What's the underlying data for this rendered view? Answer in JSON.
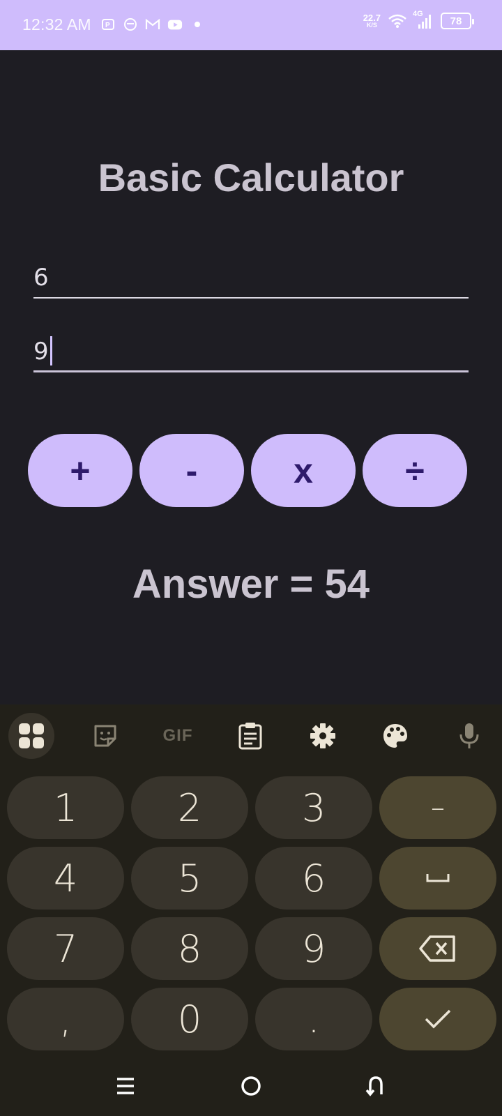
{
  "status_bar": {
    "time": "12:32 AM",
    "net_speed_value": "22.7",
    "net_speed_unit": "K/S",
    "network_label": "4G",
    "battery": "78"
  },
  "app": {
    "title": "Basic Calculator",
    "first_input_value": "6",
    "second_input_value": "9",
    "operators": {
      "add": "+",
      "subtract": "-",
      "multiply": "x",
      "divide": "÷"
    },
    "answer": "Answer = 54",
    "accent_color": "#cfbcfc",
    "background_color": "#1e1d23"
  },
  "keyboard": {
    "toolbar_icons": [
      "apps-grid-icon",
      "sticker-icon",
      "gif-icon",
      "clipboard-icon",
      "gear-icon",
      "palette-icon",
      "mic-icon"
    ],
    "gif_label": "GIF",
    "keys": {
      "k1": "1",
      "k2": "2",
      "k3": "3",
      "minus": "–",
      "k4": "4",
      "k5": "5",
      "k6": "6",
      "k7": "7",
      "k8": "8",
      "k9": "9",
      "comma": ",",
      "k0": "0",
      "period": "."
    },
    "special_keys": [
      "space-key",
      "backspace-key",
      "enter-check-key"
    ]
  },
  "nav_bar": {
    "buttons": [
      "menu-icon",
      "home-icon",
      "back-icon"
    ]
  }
}
